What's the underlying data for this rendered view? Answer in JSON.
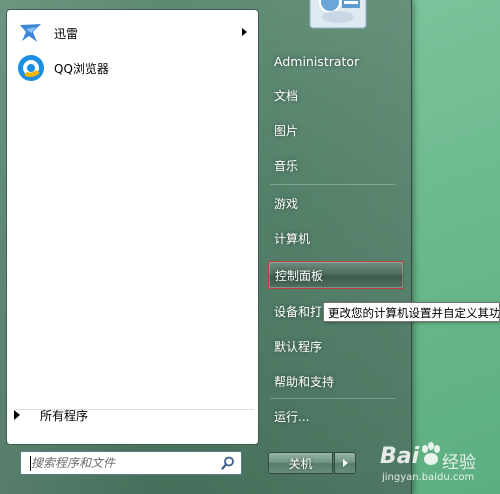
{
  "left_pane": {
    "pinned": [
      {
        "label": "迅雷",
        "icon": "xunlei-icon",
        "has_submenu": true
      },
      {
        "label": "QQ浏览器",
        "icon": "qq-browser-icon",
        "has_submenu": false
      }
    ],
    "all_programs_label": "所有程序",
    "search_placeholder": "搜索程序和文件"
  },
  "right_pane": {
    "user_name": "Administrator",
    "items": [
      {
        "label": "文档"
      },
      {
        "label": "图片"
      },
      {
        "label": "音乐"
      },
      {
        "label": "游戏"
      },
      {
        "label": "计算机"
      },
      {
        "label": "控制面板",
        "selected": true
      },
      {
        "label": "设备和打"
      },
      {
        "label": "默认程序"
      },
      {
        "label": "帮助和支持"
      },
      {
        "label": "运行..."
      }
    ],
    "shutdown_label": "关机"
  },
  "tooltip": {
    "text": "更改您的计算机设置并自定义其功能"
  },
  "colors": {
    "selection_border": "#c43a3a",
    "menu_glass": "#4f7d66",
    "desktop": "#6fbf94"
  }
}
